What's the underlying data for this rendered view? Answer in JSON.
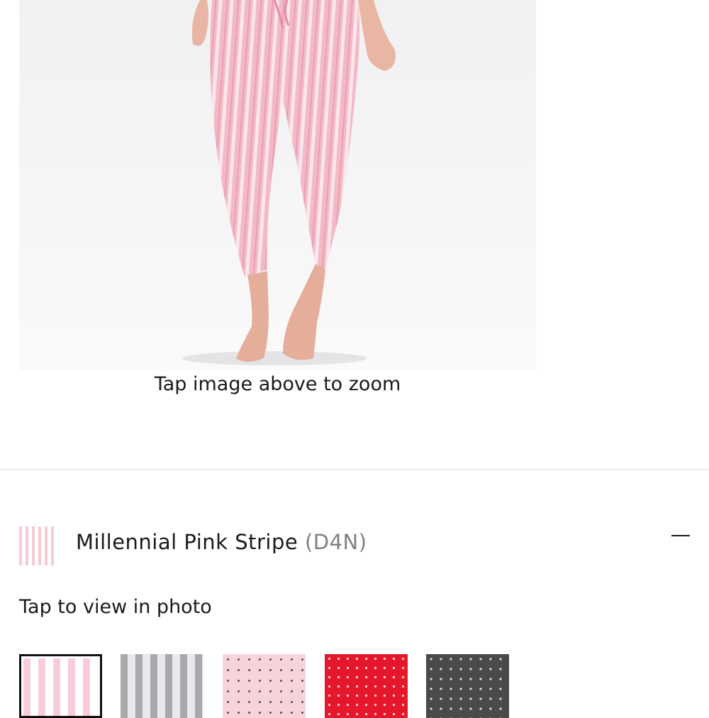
{
  "product": {
    "zoom_hint": "Tap image above to zoom"
  },
  "color_selector": {
    "selected_name": "Millennial Pink Stripe",
    "selected_code": "(D4N)",
    "view_hint": "Tap to view in photo",
    "collapse_icon": "minus-icon",
    "swatches": [
      {
        "pattern": "pink-stripe",
        "colors": [
          "#f7cdd7",
          "#ffffff"
        ],
        "selected": true
      },
      {
        "pattern": "grey-stripe",
        "colors": [
          "#a9a9ad",
          "#e9e9eb"
        ],
        "selected": false
      },
      {
        "pattern": "pink-dot",
        "colors": [
          "#f8d4da",
          "#6d4b52"
        ],
        "selected": false
      },
      {
        "pattern": "red-dot",
        "colors": [
          "#e6162b",
          "#ffd7dc"
        ],
        "selected": false
      },
      {
        "pattern": "charcoal-dot",
        "colors": [
          "#4a4a4c",
          "#d9d9d9"
        ],
        "selected": false
      }
    ]
  },
  "colors": {
    "text": "#1a1a1a",
    "muted": "#808080",
    "divider": "#e9e9e9",
    "selected_border": "#111111"
  }
}
